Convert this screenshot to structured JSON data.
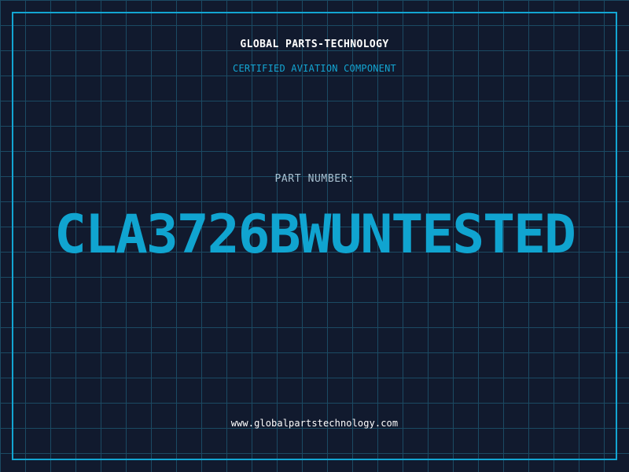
{
  "header": {
    "title": "GLOBAL PARTS-TECHNOLOGY",
    "subtitle": "CERTIFIED AVIATION COMPONENT"
  },
  "part": {
    "label": "PART NUMBER:",
    "number": "CLA3726BWUNTESTED"
  },
  "footer": {
    "website": "www.globalpartstechnology.com"
  },
  "colors": {
    "background": "#111a2e",
    "grid": "#1b4a63",
    "accent": "#13a5d2",
    "text": "#ffffff",
    "muted": "#a8c0d0"
  }
}
